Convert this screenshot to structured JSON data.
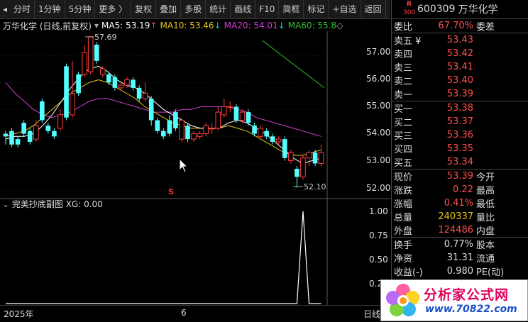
{
  "toolbar": {
    "items": [
      "分时",
      "1分钟",
      "5分钟",
      "更多 〉",
      "复权",
      "叠加",
      "多股",
      "统计",
      "画线",
      "F10",
      "简框",
      "标记",
      "+自选",
      "返回"
    ]
  },
  "legend": {
    "title": "万华化学 (日线,前复权)",
    "ma5": "MA5: 53.19",
    "ma10": "MA10: 53.46",
    "ma20": "MA20: 54.01",
    "ma60": "MA60: 55.8",
    "ma5_arrow": "↑",
    "ma10_arrow": "↓",
    "ma20_arrow": "↓",
    "ma60_arrow": "↓",
    "colors": {
      "ma5": "#ffffff",
      "ma10": "#e6c619",
      "ma20": "#d040d0",
      "ma60": "#30c030"
    }
  },
  "price_axis": {
    "ticks": [
      "57.00",
      "56.00",
      "55.00",
      "54.00",
      "53.00",
      "52.00"
    ]
  },
  "annotations": {
    "high": "57.69",
    "low": "52.10",
    "marker": "S"
  },
  "sub_chart": {
    "title": "完美抄底副图 XG: 0.00",
    "ticks": [
      "1.00",
      "0.75",
      "0.50",
      "0.25"
    ]
  },
  "time_axis": {
    "labels": [
      "2025年",
      "6"
    ],
    "right_label": "日线"
  },
  "chart_data": {
    "type": "candlestick",
    "ylim": [
      51.8,
      57.9
    ],
    "candles": [
      {
        "o": 54.1,
        "c": 54.0,
        "h": 54.2,
        "l": 53.7
      },
      {
        "o": 54.2,
        "c": 53.7,
        "h": 54.3,
        "l": 53.6
      },
      {
        "o": 53.9,
        "c": 53.7,
        "h": 54.0,
        "l": 53.6
      },
      {
        "o": 54.5,
        "c": 54.1,
        "h": 54.6,
        "l": 54.0
      },
      {
        "o": 54.2,
        "c": 53.8,
        "h": 54.3,
        "l": 53.7
      },
      {
        "o": 53.9,
        "c": 54.4,
        "h": 54.6,
        "l": 53.8
      },
      {
        "o": 55.3,
        "c": 54.6,
        "h": 55.4,
        "l": 54.5
      },
      {
        "o": 54.4,
        "c": 54.2,
        "h": 54.5,
        "l": 54.1
      },
      {
        "o": 54.2,
        "c": 54.0,
        "h": 54.3,
        "l": 53.9
      },
      {
        "o": 54.3,
        "c": 54.8,
        "h": 55.0,
        "l": 54.2
      },
      {
        "o": 56.6,
        "c": 54.7,
        "h": 56.7,
        "l": 54.6
      },
      {
        "o": 54.8,
        "c": 55.6,
        "h": 56.8,
        "l": 54.7
      },
      {
        "o": 56.3,
        "c": 55.6,
        "h": 56.4,
        "l": 55.5
      },
      {
        "o": 56.3,
        "c": 57.1,
        "h": 57.4,
        "l": 56.2
      },
      {
        "o": 56.4,
        "c": 57.7,
        "h": 57.7,
        "l": 56.3
      },
      {
        "o": 57.4,
        "c": 56.8,
        "h": 57.5,
        "l": 56.7
      },
      {
        "o": 56.3,
        "c": 56.5,
        "h": 56.6,
        "l": 56.2
      },
      {
        "o": 56.3,
        "c": 56.0,
        "h": 56.4,
        "l": 55.9
      },
      {
        "o": 56.2,
        "c": 55.8,
        "h": 56.3,
        "l": 55.7
      },
      {
        "o": 55.8,
        "c": 55.9,
        "h": 56.0,
        "l": 55.7
      },
      {
        "o": 55.9,
        "c": 56.1,
        "h": 56.2,
        "l": 55.8
      },
      {
        "o": 56.1,
        "c": 55.8,
        "h": 56.2,
        "l": 55.7
      },
      {
        "o": 55.8,
        "c": 55.4,
        "h": 55.9,
        "l": 55.3
      },
      {
        "o": 55.4,
        "c": 55.6,
        "h": 56.0,
        "l": 55.3
      },
      {
        "o": 55.4,
        "c": 54.6,
        "h": 55.5,
        "l": 54.4
      },
      {
        "o": 54.6,
        "c": 54.2,
        "h": 54.7,
        "l": 54.1
      },
      {
        "o": 54.2,
        "c": 54.0,
        "h": 54.3,
        "l": 53.9
      },
      {
        "o": 54.6,
        "c": 54.1,
        "h": 54.8,
        "l": 54.0
      },
      {
        "o": 54.9,
        "c": 54.3,
        "h": 55.0,
        "l": 54.2
      },
      {
        "o": 53.9,
        "c": 54.6,
        "h": 54.7,
        "l": 53.8
      },
      {
        "o": 54.4,
        "c": 53.9,
        "h": 54.5,
        "l": 53.8
      },
      {
        "o": 53.9,
        "c": 54.1,
        "h": 54.2,
        "l": 53.8
      },
      {
        "o": 54.0,
        "c": 54.1,
        "h": 54.2,
        "l": 53.9
      },
      {
        "o": 54.1,
        "c": 54.4,
        "h": 54.5,
        "l": 54.0
      },
      {
        "o": 54.3,
        "c": 54.3,
        "h": 54.5,
        "l": 54.1
      },
      {
        "o": 54.3,
        "c": 54.9,
        "h": 55.1,
        "l": 54.2
      },
      {
        "o": 54.8,
        "c": 55.1,
        "h": 55.4,
        "l": 54.7
      },
      {
        "o": 55.1,
        "c": 55.1,
        "h": 55.3,
        "l": 54.9
      },
      {
        "o": 55.1,
        "c": 54.6,
        "h": 55.2,
        "l": 54.5
      },
      {
        "o": 54.6,
        "c": 54.9,
        "h": 55.0,
        "l": 54.5
      },
      {
        "o": 54.9,
        "c": 54.5,
        "h": 55.0,
        "l": 54.4
      },
      {
        "o": 54.4,
        "c": 54.1,
        "h": 54.5,
        "l": 54.0
      },
      {
        "o": 54.0,
        "c": 54.3,
        "h": 54.4,
        "l": 53.9
      },
      {
        "o": 54.2,
        "c": 54.0,
        "h": 54.3,
        "l": 53.9
      },
      {
        "o": 54.0,
        "c": 53.8,
        "h": 54.1,
        "l": 53.7
      },
      {
        "o": 53.8,
        "c": 53.9,
        "h": 54.0,
        "l": 53.7
      },
      {
        "o": 53.9,
        "c": 53.2,
        "h": 54.0,
        "l": 53.1
      },
      {
        "o": 53.1,
        "c": 53.4,
        "h": 53.5,
        "l": 53.0
      },
      {
        "o": 52.8,
        "c": 52.5,
        "h": 52.9,
        "l": 52.1
      },
      {
        "o": 52.5,
        "c": 53.2,
        "h": 53.3,
        "l": 52.4
      },
      {
        "o": 53.2,
        "c": 53.4,
        "h": 53.5,
        "l": 52.9
      },
      {
        "o": 53.4,
        "c": 53.0,
        "h": 53.5,
        "l": 52.9
      },
      {
        "o": 53.0,
        "c": 53.4,
        "h": 53.7,
        "l": 52.9
      }
    ],
    "ma5": [
      53.9,
      54.0,
      54.0,
      54.1,
      54.4,
      54.8,
      55.3,
      55.8,
      56.2,
      56.5,
      56.6,
      56.4,
      56.1,
      55.9,
      55.8,
      55.6,
      55.3,
      55.0,
      54.8,
      54.6,
      54.4,
      54.3,
      54.3,
      54.3,
      54.5,
      54.6,
      54.5,
      54.3,
      54.1,
      53.8,
      53.5,
      53.2,
      53.0,
      53.1,
      53.2
    ],
    "ma10": [
      54.0,
      54.1,
      54.2,
      54.4,
      54.7,
      55.0,
      55.3,
      55.6,
      55.8,
      56.0,
      56.1,
      56.0,
      55.8,
      55.6,
      55.4,
      55.1,
      54.9,
      54.7,
      54.5,
      54.4,
      54.3,
      54.3,
      54.3,
      54.3,
      54.4,
      54.3,
      54.2,
      54.0,
      53.8,
      53.6,
      53.4,
      53.3,
      53.3,
      53.4,
      53.5
    ],
    "ma20": [
      56.0,
      55.6,
      55.3,
      55.0,
      54.8,
      54.7,
      54.8,
      54.9,
      55.1,
      55.3,
      55.4,
      55.4,
      55.3,
      55.2,
      55.1,
      55.0,
      54.9,
      54.9,
      54.9,
      55.0,
      55.0,
      55.1,
      55.1,
      55.1,
      55.1,
      55.0,
      54.9,
      54.7,
      54.6,
      54.5,
      54.4,
      54.3,
      54.2,
      54.1,
      54.0
    ],
    "xg": [
      0,
      0,
      0,
      0,
      0,
      0,
      0,
      0,
      0,
      0,
      0,
      0,
      0,
      0,
      0,
      0,
      0,
      0,
      0,
      0,
      0,
      0,
      0,
      0,
      0,
      0,
      0,
      0,
      0,
      0,
      0,
      0,
      0,
      0,
      0,
      0,
      0,
      0,
      0,
      0,
      0,
      0,
      0,
      0,
      0,
      0,
      0,
      0,
      0,
      1,
      0,
      0,
      0
    ]
  },
  "quote": {
    "code": "600309",
    "name": "万华化学",
    "badge_r": "R",
    "badge_n": "300",
    "weibi_label": "委比",
    "weibi_value": "67.70%",
    "weicha_label": "委差",
    "asks": [
      {
        "label": "卖五 ¥",
        "price": "53.43"
      },
      {
        "label": "卖四",
        "price": "53.42"
      },
      {
        "label": "卖三",
        "price": "53.41"
      },
      {
        "label": "卖二",
        "price": "53.40"
      },
      {
        "label": "卖一",
        "price": "53.39"
      }
    ],
    "bids": [
      {
        "label": "买一",
        "price": "53.38"
      },
      {
        "label": "买二",
        "price": "53.37"
      },
      {
        "label": "买三",
        "price": "53.36"
      },
      {
        "label": "买四",
        "price": "53.35"
      },
      {
        "label": "买五",
        "price": "53.34"
      }
    ],
    "stats": [
      {
        "label": "现价",
        "value": "53.39",
        "right": "今开",
        "color": "red"
      },
      {
        "label": "涨跌",
        "value": "0.22",
        "right": "最高",
        "color": "red"
      },
      {
        "label": "涨幅",
        "value": "0.41%",
        "right": "最低",
        "color": "red"
      },
      {
        "label": "总量",
        "value": "240337",
        "right": "量比",
        "color": "yel"
      },
      {
        "label": "外盘",
        "value": "124486",
        "right": "内盘",
        "color": "red"
      }
    ],
    "stats2": [
      {
        "label": "换手",
        "value": "0.77%",
        "right": "股本"
      },
      {
        "label": "净资",
        "value": "31.31",
        "right": "流通"
      },
      {
        "label": "收益(-)",
        "value": "0.980",
        "right": "PE(动)"
      }
    ]
  },
  "logo": {
    "text": "分析家公式网",
    "url": "www.70822.com"
  }
}
